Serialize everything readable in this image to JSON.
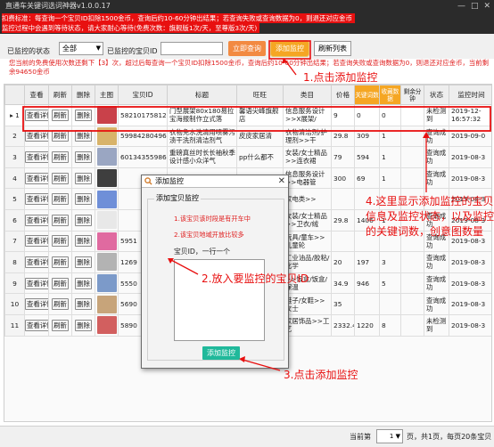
{
  "window": {
    "title": "直通车关键词选词神器v1.0.0.17",
    "controls": [
      "—",
      "□",
      "✕"
    ]
  },
  "notice": {
    "line1": "扣费标准：每查询一个宝贝ID扣除1500金币，查询后约10-60分钟出结果；若查询失败或查询数据为0，则退还对应金币",
    "line2": "监控过程中会遇到等待状态，请大家耐心等待(免费次数：旗舰版1次/天，至尊版3次/天)"
  },
  "toolbar": {
    "status_label": "已监控的状态",
    "status_value": "全部",
    "itemid_label": "已监控的宝贝ID",
    "itemid_value": "",
    "query_button": "立即查询",
    "add_button": "添加监控",
    "refresh_button": "刷新列表"
  },
  "info_text": "您当前的免费使用次数还剩下【3】次，超过后每查询一个宝贝ID扣除1500金币，查询后约10-60分钟出结果；若查询失败或查询数据为0，则退还对应金币，当前剩余94650金币",
  "table": {
    "headers": [
      "查看",
      "刷新",
      "删除",
      "主图",
      "宝贝ID",
      "标题",
      "旺旺",
      "类目",
      "价格",
      "关键词数",
      "收藏数据",
      "剩余分钟",
      "状态",
      "监控时间"
    ],
    "action_labels": {
      "view": "查看详情",
      "refresh": "刷新",
      "delete": "删除"
    },
    "rows": [
      {
        "num": "1",
        "id": "58210175812",
        "title": "门型展架80x180易拉宝海报制作立式落",
        "wangwang": "馨语尖峰旗舰店",
        "category": "信息服务设计>>X展架/",
        "price": "9",
        "kw": "0",
        "fav": "0",
        "left": "",
        "status": "未检测到",
        "time": "2019-12-16:57:32",
        "thumb": "#c9414a"
      },
      {
        "num": "2",
        "id": "59984280496",
        "title": "衣物免水洗清用喷雾污渍干洗剂清洁剂气",
        "wangwang": "皮皮家居清",
        "category": "衣物清洁剂/护理剂>>干",
        "price": "29.8",
        "kw": "309",
        "fav": "1",
        "left": "",
        "status": "查询成功",
        "time": "2019-09-0",
        "thumb": "#d8b36a"
      },
      {
        "num": "3",
        "id": "60134355986",
        "title": "重磅真丝时长长袖秋季设计感小众洋气",
        "wangwang": "pp什么都不",
        "category": "女装/女士精品>>连衣裙",
        "price": "79",
        "kw": "594",
        "fav": "1",
        "left": "",
        "status": "查询成功",
        "time": "2019-08-3",
        "thumb": "#9aa6c2"
      },
      {
        "num": "4",
        "id": "",
        "title": "",
        "wangwang": "",
        "category": "信息服务设计>>电器管",
        "price": "300",
        "kw": "69",
        "fav": "1",
        "left": "",
        "status": "查询成功",
        "time": "2019-08-3",
        "thumb": "#3e3e3e"
      },
      {
        "num": "5",
        "id": "",
        "title": "",
        "wangwang": "",
        "category": "家电类>>",
        "price": "",
        "kw": "",
        "fav": "",
        "left": "",
        "status": "",
        "time": "2019-08-3",
        "thumb": "#6f8fd8"
      },
      {
        "num": "6",
        "id": "",
        "title": "",
        "wangwang": "",
        "category": "女装/女士精品>>卫衣/绒",
        "price": "29.8",
        "kw": "1406",
        "fav": "1",
        "left": "",
        "status": "查询成功",
        "time": "2019-08-3",
        "thumb": "#e8e8e8"
      },
      {
        "num": "7",
        "id": "5951",
        "title": "",
        "wangwang": "",
        "category": "玩具/童车>>儿童轮",
        "price": "",
        "kw": "",
        "fav": "",
        "left": "",
        "status": "查询成功",
        "time": "2019-08-3",
        "thumb": "#e06aa0"
      },
      {
        "num": "8",
        "id": "1269",
        "title": "",
        "wangwang": "",
        "category": "工业油品/胶粘/化学",
        "price": "20",
        "kw": "197",
        "fav": "3",
        "left": "",
        "status": "查询成功",
        "time": "2019-08-3",
        "thumb": "#b3b3b3"
      },
      {
        "num": "9",
        "id": "5550",
        "title": "",
        "wangwang": "",
        "category": ">>饭盒/饭盒/保温",
        "price": "34.9",
        "kw": "946",
        "fav": "5",
        "left": "",
        "status": "查询成功",
        "time": "2019-08-3",
        "thumb": "#7c9ac9"
      },
      {
        "num": "10",
        "id": "5690",
        "title": "",
        "wangwang": "",
        "category": "鞋子/女鞋>>女士",
        "price": "35",
        "kw": "",
        "fav": "",
        "left": "",
        "status": "查询成功",
        "time": "2019-08-3",
        "thumb": "#c7a47a"
      },
      {
        "num": "11",
        "id": "5890",
        "title": "",
        "wangwang": "",
        "category": "家居饰品>>工艺",
        "price": "2332.4",
        "kw": "1220",
        "fav": "8",
        "left": "",
        "status": "未检测到",
        "time": "2019-08-3",
        "thumb": "#d25f5f"
      }
    ]
  },
  "pager": {
    "current_label": "当前第",
    "page": "1",
    "summary": "页，共1页，每页20条宝贝"
  },
  "dialog": {
    "title": "添加监控",
    "legend": "添加宝贝监控",
    "tip1": "1.该宝贝该时段是有开车中",
    "tip2": "2.该宝贝地域开放比较多",
    "input_label": "宝贝ID，一行一个",
    "textarea_value": "",
    "close": "✕",
    "add_button": "添加监控"
  },
  "annotations": {
    "step1": "1.点击添加监控",
    "step2": "2.放入要监控的宝贝ID",
    "step3": "3.点击添加监控",
    "step4": "4.这里显示添加监控的宝贝信息及监控状态，以及监控的关键词数，创意图数量"
  },
  "colors": {
    "notice_red": "#e81010",
    "orange_button": "#f5a623",
    "query_button": "#f28a42",
    "dialog_button": "#20b99b"
  }
}
